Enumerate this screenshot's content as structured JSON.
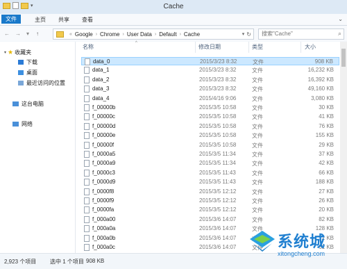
{
  "window": {
    "title": "Cache"
  },
  "ribbon": {
    "tabs": [
      "文件",
      "主页",
      "共享",
      "查看"
    ]
  },
  "address": {
    "crumbs": [
      "Google",
      "Chrome",
      "User Data",
      "Default",
      "Cache"
    ]
  },
  "search": {
    "placeholder": "搜索\"Cache\""
  },
  "sidebar": {
    "favorites": "收藏夹",
    "items": [
      "下载",
      "桌面",
      "最近访问的位置"
    ],
    "thispc": "这台电脑",
    "network": "网络"
  },
  "columns": {
    "name": "名称",
    "date": "修改日期",
    "type": "类型",
    "size": "大小"
  },
  "files": [
    {
      "name": "data_0",
      "date": "2015/3/23 8:32",
      "type": "文件",
      "size": "908 KB"
    },
    {
      "name": "data_1",
      "date": "2015/3/23 8:32",
      "type": "文件",
      "size": "16,232 KB"
    },
    {
      "name": "data_2",
      "date": "2015/3/23 8:32",
      "type": "文件",
      "size": "16,392 KB"
    },
    {
      "name": "data_3",
      "date": "2015/3/23 8:32",
      "type": "文件",
      "size": "49,160 KB"
    },
    {
      "name": "data_4",
      "date": "2015/4/16 9:06",
      "type": "文件",
      "size": "3,080 KB"
    },
    {
      "name": "f_00000b",
      "date": "2015/3/5 10:58",
      "type": "文件",
      "size": "30 KB"
    },
    {
      "name": "f_00000c",
      "date": "2015/3/5 10:58",
      "type": "文件",
      "size": "41 KB"
    },
    {
      "name": "f_00000d",
      "date": "2015/3/5 10:58",
      "type": "文件",
      "size": "76 KB"
    },
    {
      "name": "f_00000e",
      "date": "2015/3/5 10:58",
      "type": "文件",
      "size": "155 KB"
    },
    {
      "name": "f_00000f",
      "date": "2015/3/5 10:58",
      "type": "文件",
      "size": "29 KB"
    },
    {
      "name": "f_0000a5",
      "date": "2015/3/5 11:34",
      "type": "文件",
      "size": "37 KB"
    },
    {
      "name": "f_0000a9",
      "date": "2015/3/5 11:34",
      "type": "文件",
      "size": "42 KB"
    },
    {
      "name": "f_0000c3",
      "date": "2015/3/5 11:43",
      "type": "文件",
      "size": "66 KB"
    },
    {
      "name": "f_0000d9",
      "date": "2015/3/5 11:43",
      "type": "文件",
      "size": "188 KB"
    },
    {
      "name": "f_0000f8",
      "date": "2015/3/5 12:12",
      "type": "文件",
      "size": "27 KB"
    },
    {
      "name": "f_0000f9",
      "date": "2015/3/5 12:12",
      "type": "文件",
      "size": "26 KB"
    },
    {
      "name": "f_0000fa",
      "date": "2015/3/5 12:12",
      "type": "文件",
      "size": "20 KB"
    },
    {
      "name": "f_000a00",
      "date": "2015/3/6 14:07",
      "type": "文件",
      "size": "82 KB"
    },
    {
      "name": "f_000a0a",
      "date": "2015/3/6 14:07",
      "type": "文件",
      "size": "128 KB"
    },
    {
      "name": "f_000a0b",
      "date": "2015/3/6 14:07",
      "type": "文件",
      "size": "72 KB"
    },
    {
      "name": "f_000a0c",
      "date": "2015/3/6 14:07",
      "type": "文件",
      "size": "61 KB"
    }
  ],
  "status": {
    "count": "2,923 个项目",
    "selected": "选中 1 个项目",
    "selected_size": "908 KB"
  },
  "watermark": {
    "brand": "系统城",
    "url": "xitongcheng.com"
  },
  "colors": {
    "accent": "#1979ca",
    "selection": "#cce8ff"
  }
}
